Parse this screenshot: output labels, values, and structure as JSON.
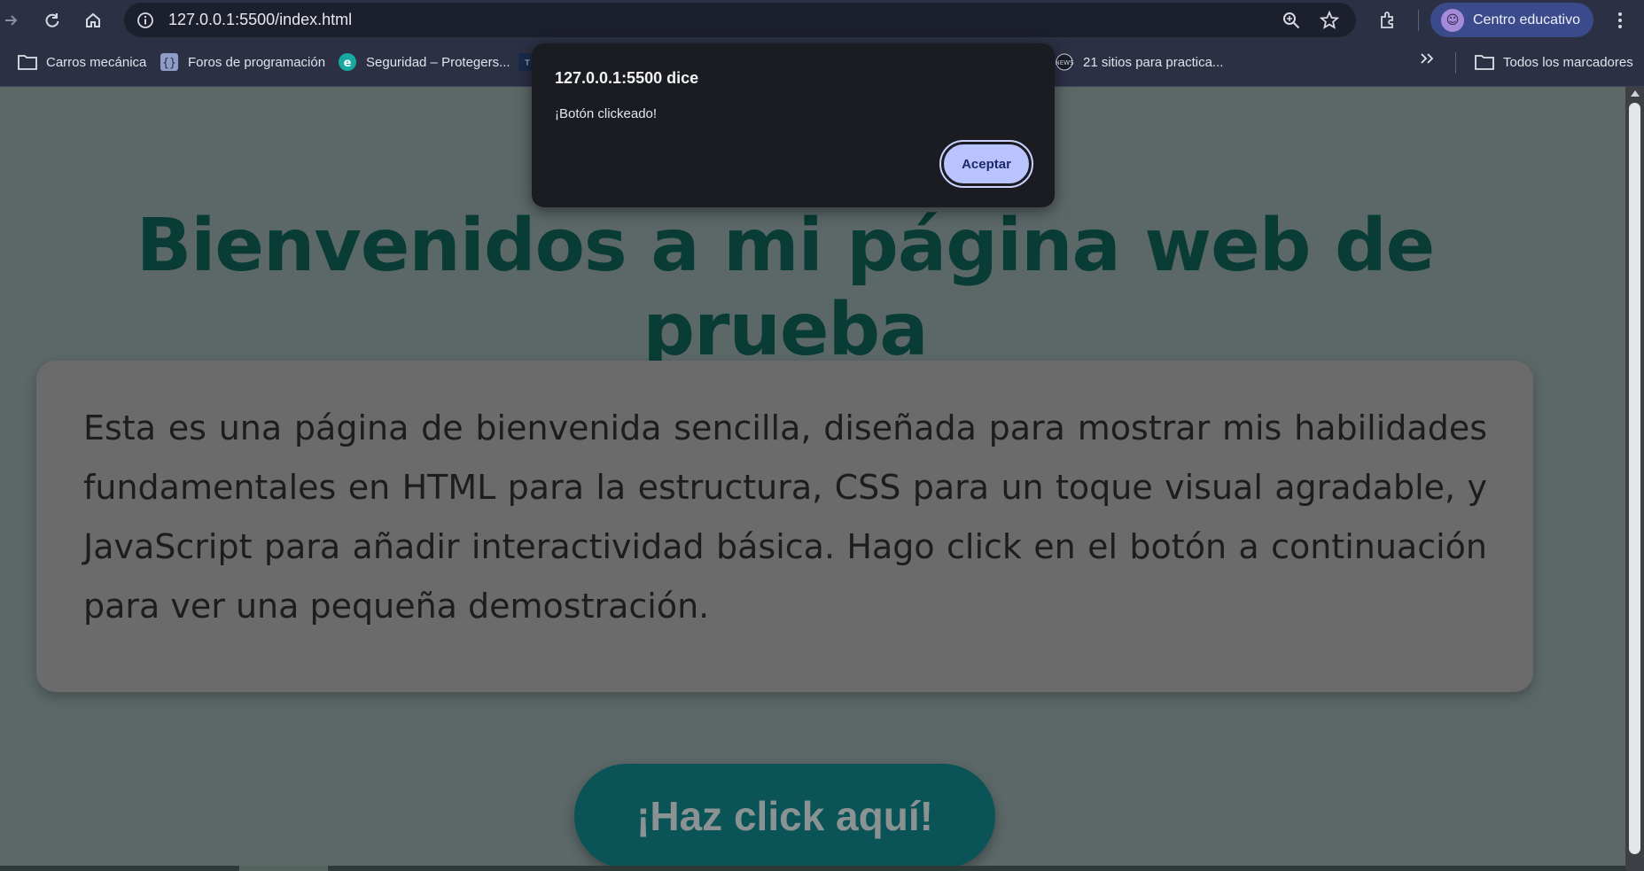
{
  "browser": {
    "url": "127.0.0.1:5500/index.html",
    "profile_label": "Centro educativo"
  },
  "bookmarks": [
    {
      "label": "Carros mecánica",
      "icon": "folder-icon"
    },
    {
      "label": "Foros de programación",
      "icon": "brackets-icon"
    },
    {
      "label": "Seguridad – Protegers...",
      "icon": "eset-icon"
    },
    {
      "label": "21 sitios para practica...",
      "icon": "news-icon"
    }
  ],
  "bookmarks_all_label": "Todos los marcadores",
  "page": {
    "title": "Bienvenidos a mi página web de prueba",
    "paragraph": "Esta es una página de bienvenida sencilla, diseñada para mostrar mis habilidades fundamentales en HTML para la estructura, CSS para un toque visual agradable, y JavaScript para añadir interactividad básica. Hago click en el botón a continuación para ver una pequeña demostración.",
    "button_label": "¡Haz click aquí!"
  },
  "dialog": {
    "title": "127.0.0.1:5500 dice",
    "message": "¡Botón clickeado!",
    "ok_label": "Aceptar"
  },
  "colors": {
    "title": "#083c34",
    "button_bg": "#0a5458",
    "dialog_button": "#b8c3ff"
  }
}
